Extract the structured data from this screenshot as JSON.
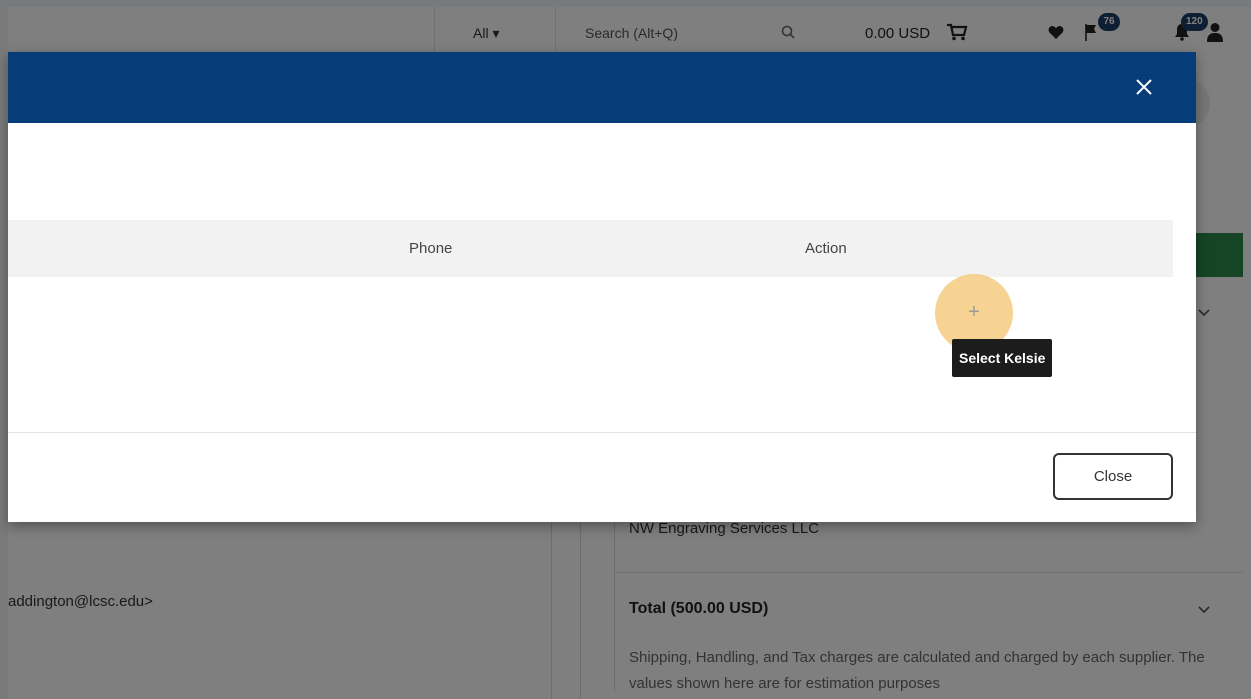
{
  "topbar": {
    "scope_label": "All",
    "search_placeholder": "Search (Alt+Q)",
    "cart_total": "0.00 USD",
    "notifications_badge_1": "76",
    "notifications_badge_2": "120"
  },
  "background": {
    "email_fragment": "addington@lcsc.edu>",
    "supplier_name": "NW Engraving Services LLC",
    "total_label": "Total (500.00 USD)",
    "shipping_note": "Shipping, Handling, and Tax charges are calculated and charged by each supplier. The values shown here are for estimation purposes"
  },
  "modal": {
    "columns": {
      "phone": "Phone",
      "action": "Action"
    },
    "row": {
      "select_glyph": "+",
      "tooltip": "Select Kelsie"
    },
    "close_label": "Close"
  },
  "colors": {
    "header_navy": "#063c78",
    "badge_navy": "#1f3f66",
    "highlight": "#f3c46e"
  }
}
